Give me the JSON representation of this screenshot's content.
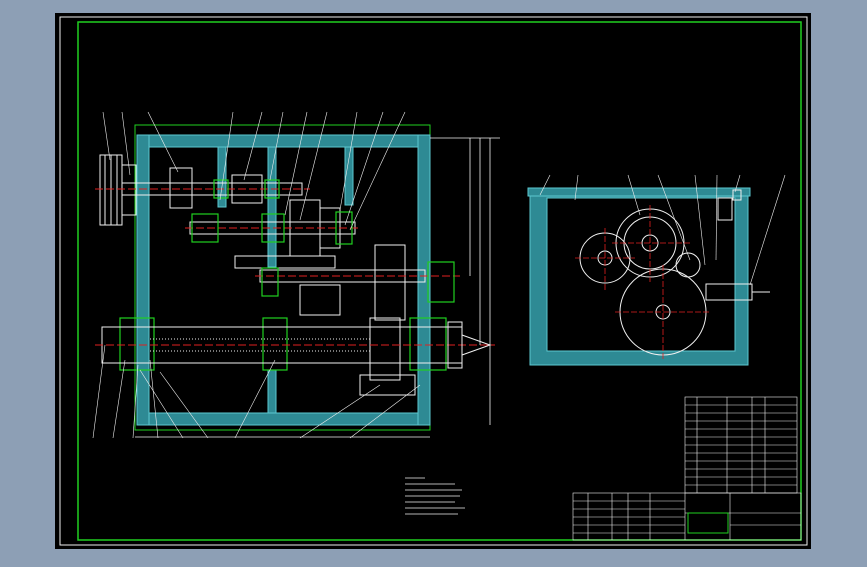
{
  "window": {
    "background_color": "#8d9fb5",
    "canvas_color": "#000000"
  },
  "colors": {
    "housing_fill": "#2e8a94",
    "housing_edge": "#5cc8d0",
    "green_line": "#20d020",
    "white_line": "#f0f0f0",
    "red_line": "#e02020",
    "yellow_text": "#f0e040"
  },
  "drawing": {
    "front_view": "section",
    "side_view": "end",
    "icons": {
      "pulley": "v-belt-pulley-icon",
      "gear": "spur-gear-icon",
      "center": "lathe-center-icon"
    }
  }
}
